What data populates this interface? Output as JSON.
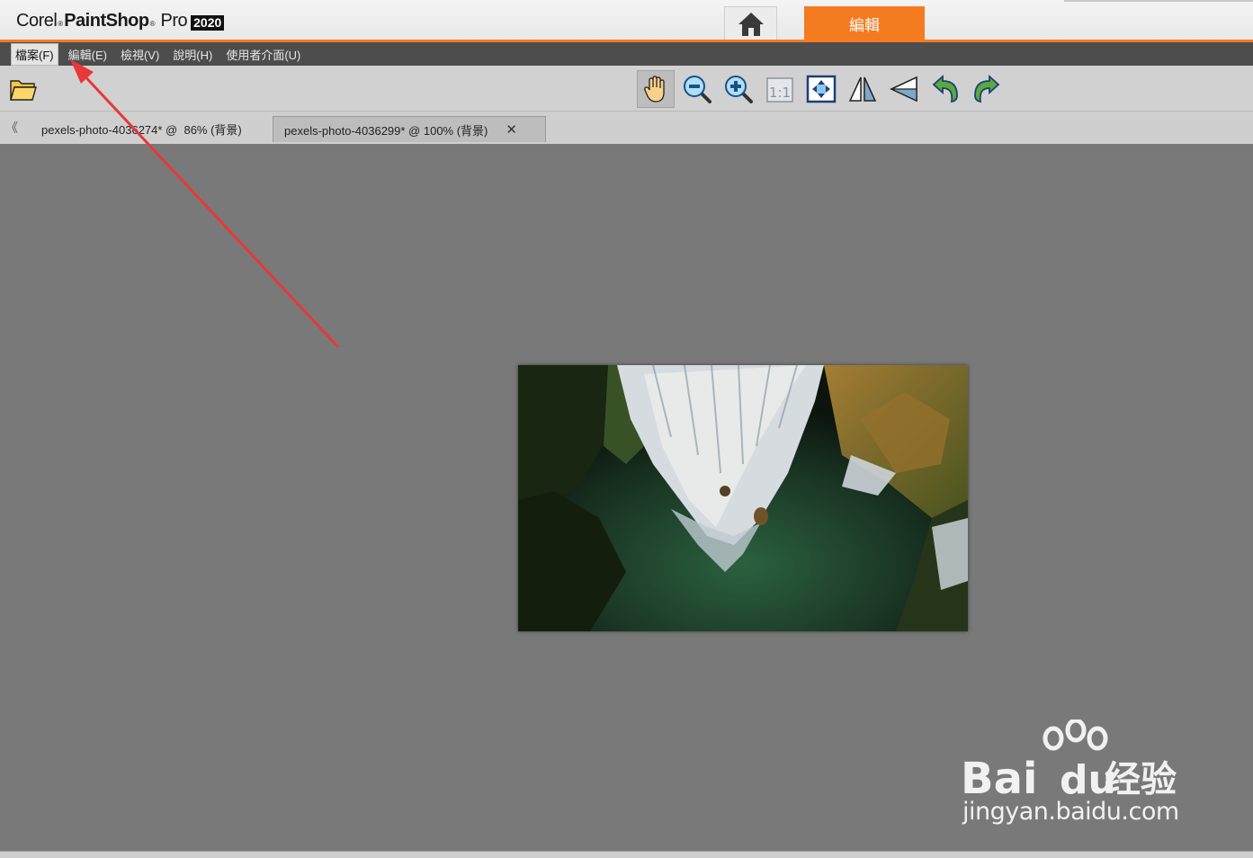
{
  "app": {
    "brand_corel": "Corel",
    "brand_paintshop": "PaintShop",
    "brand_pro": "Pro",
    "brand_year": "2020",
    "brand_reg": "®"
  },
  "workspace_tabs": {
    "home_icon": "home-icon",
    "edit_label": "編輯",
    "accent_color": "#f47b20"
  },
  "menu": {
    "items": [
      {
        "label": "檔案(F)",
        "active": true
      },
      {
        "label": "編輯(E)"
      },
      {
        "label": "檢視(V)"
      },
      {
        "label": "說明(H)"
      },
      {
        "label": "使用者介面(U)"
      }
    ]
  },
  "toolbar": {
    "tools": [
      {
        "icon": "open-folder-icon"
      },
      {
        "icon": "pan-hand-icon",
        "pressed": true
      },
      {
        "icon": "zoom-out-icon"
      },
      {
        "icon": "zoom-in-icon"
      },
      {
        "icon": "actual-size-icon",
        "label": "1:1"
      },
      {
        "icon": "fit-to-window-icon"
      },
      {
        "icon": "flip-horizontal-icon"
      },
      {
        "icon": "perspective-icon"
      },
      {
        "icon": "undo-icon"
      },
      {
        "icon": "redo-icon"
      }
    ]
  },
  "document_tabs": {
    "scroll_glyph": "《",
    "tabs": [
      {
        "title": "pexels-photo-4036274* @  86% (背景)"
      },
      {
        "title": "pexels-photo-4036299* @ 100% (背景)",
        "active": true,
        "close": "✕"
      }
    ]
  },
  "watermark": {
    "logo_text": "Bai",
    "logo_du": "du",
    "logo_cn": "经验",
    "url": "jingyan.baidu.com"
  }
}
